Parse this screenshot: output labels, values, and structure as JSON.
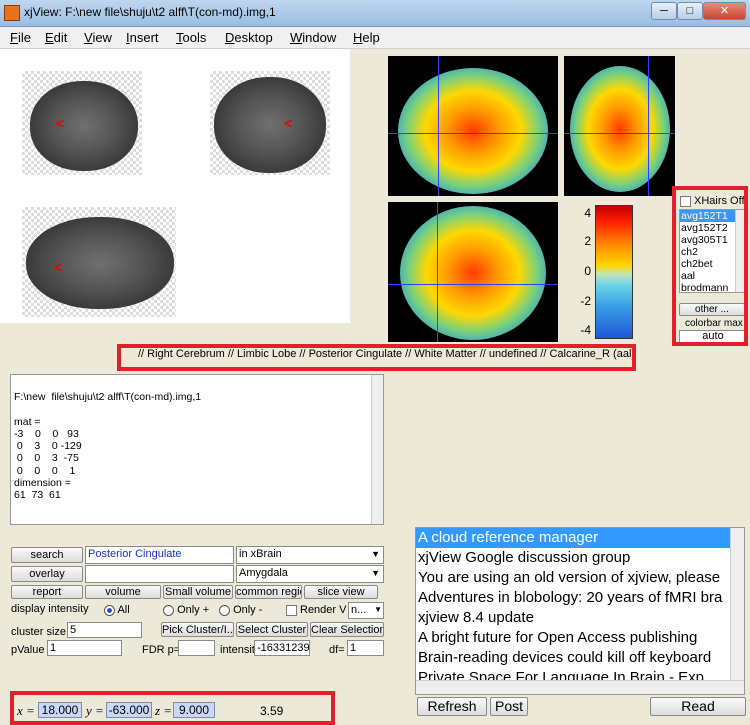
{
  "window": {
    "title": "xjView: F:\\new file\\shuju\\t2 alff\\T(con-md).img,1",
    "minimize_label": "─",
    "maximize_label": "□",
    "close_label": "✕"
  },
  "menu": {
    "items": [
      {
        "key": "F",
        "rest": "ile"
      },
      {
        "key": "E",
        "rest": "dit"
      },
      {
        "key": "V",
        "rest": "iew"
      },
      {
        "key": "I",
        "rest": "nsert"
      },
      {
        "key": "T",
        "rest": "ools"
      },
      {
        "key": "D",
        "rest": "esktop"
      },
      {
        "key": "W",
        "rest": "indow"
      },
      {
        "key": "H",
        "rest": "elp"
      }
    ]
  },
  "slice_marker": "<",
  "colorbar": {
    "ticks": [
      "4",
      "2",
      "0",
      "-2",
      "-4"
    ],
    "gradient": [
      "#c00000",
      "#ff2000",
      "#ff8c00",
      "#ffd700",
      "#bfe6bf",
      "#6bd3e8",
      "#3aa3e6",
      "#1e55d6"
    ]
  },
  "xhairs": {
    "label": "XHairs Off",
    "templates": [
      "avg152T1",
      "avg152T2",
      "avg305T1",
      "ch2",
      "ch2bet",
      "aal",
      "brodmann"
    ],
    "selected_index": 0,
    "other_label": "other ...",
    "colorbar_max_label": "colorbar max",
    "colorbar_max_value": "auto"
  },
  "anatomy": {
    "text": "// Right Cerebrum // Limbic Lobe // Posterior Cingulate // White Matter // undefined // Calcarine_R (aal)"
  },
  "info": {
    "text": "F:\\new  file\\shuju\\t2 alff\\T(con-md).img,1\n\nmat =\n-3    0    0   93\n 0    3    0 -129\n 0    0    3  -75\n 0    0    0    1\ndimension =\n61  73  61"
  },
  "search": {
    "search_label": "search",
    "search_value": "Posterior Cingulate",
    "scope_value": "in xBrain",
    "overlay_label": "overlay",
    "overlay_value": "",
    "overlay_select": "Amygdala"
  },
  "actions": {
    "report": "report",
    "volume": "volume",
    "small_volume": "Small volume",
    "common_region": "common regio",
    "slice_view": "slice view"
  },
  "display": {
    "label": "display intensity",
    "all": "All",
    "only_pos": "Only +",
    "only_neg": "Only -",
    "render_view": "Render V",
    "render_select": "n..."
  },
  "cluster": {
    "label": "cluster size",
    "value": "5",
    "pick": "Pick Cluster/I...",
    "select": "Select Cluster",
    "clear": "Clear Selection"
  },
  "stats": {
    "pvalue_label": "pValue",
    "pvalue_value": "1",
    "fdr_label": "FDR p=",
    "fdr_value": "",
    "intensity_label": "intensit",
    "intensity_value": "-16331239",
    "df_label": "df=",
    "df_value": "1"
  },
  "coords": {
    "x_label": "x =",
    "x_value": "18.000",
    "y_label": "y =",
    "y_value": "-63.000",
    "z_label": "z =",
    "z_value": "9.000",
    "intensity": "3.59"
  },
  "news": {
    "items": [
      "A cloud reference manager",
      "xjView Google discussion group",
      "You are using an old version of xjview, please",
      "Adventures in blobology: 20 years of fMRI bra",
      "xjview 8.4 update",
      "A bright future for Open Access publishing",
      "Brain-reading devices could kill off keyboard",
      "Private Space For Language In Brain - Exp"
    ],
    "selected_index": 0,
    "refresh": "Refresh",
    "post": "Post",
    "read": "Read"
  }
}
